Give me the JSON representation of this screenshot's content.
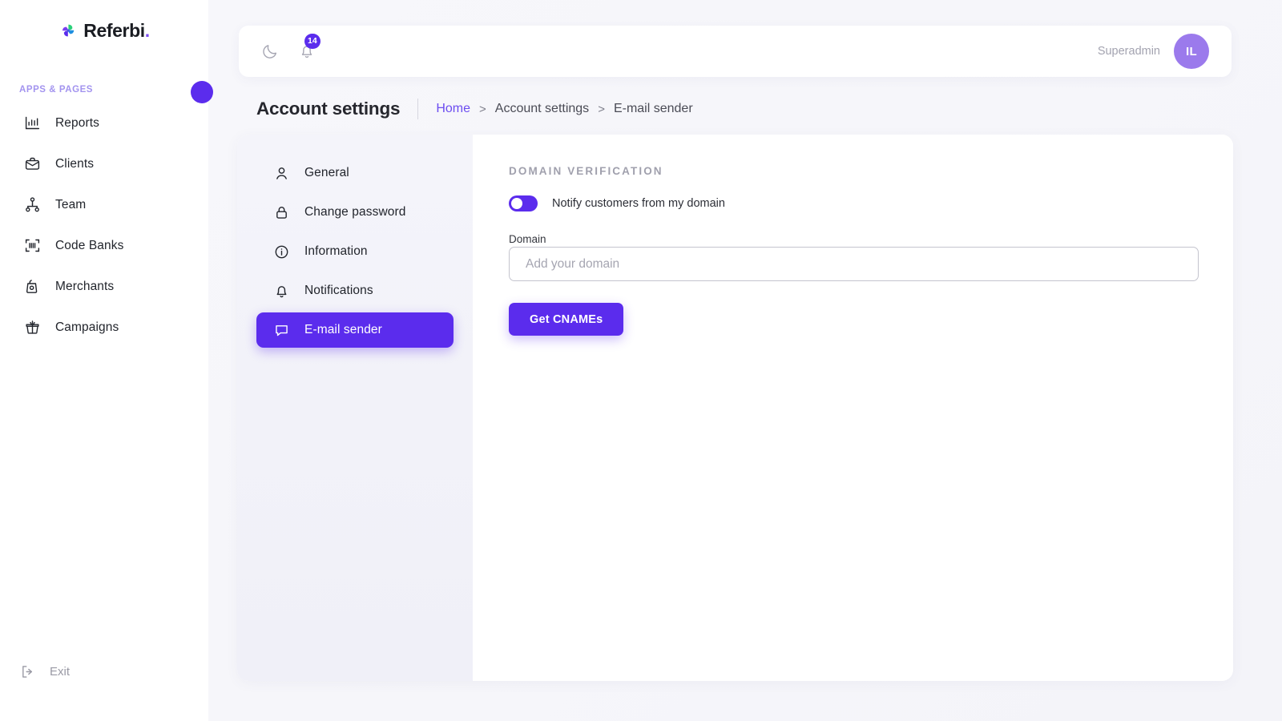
{
  "brand": {
    "name": "Referbi",
    "dot": ".",
    "accent": "#5b2ced",
    "logo_icon": "pinwheel-icon"
  },
  "sidebar": {
    "section_label": "APPS & PAGES",
    "items": [
      {
        "label": "Reports",
        "icon": "bar-chart-icon"
      },
      {
        "label": "Clients",
        "icon": "briefcase-icon"
      },
      {
        "label": "Team",
        "icon": "org-chart-icon"
      },
      {
        "label": "Code Banks",
        "icon": "barcode-scan-icon"
      },
      {
        "label": "Merchants",
        "icon": "shopping-bag-icon"
      },
      {
        "label": "Campaigns",
        "icon": "gift-box-icon"
      }
    ],
    "exit": {
      "label": "Exit",
      "icon": "logout-icon"
    }
  },
  "topbar": {
    "theme_toggle_icon": "moon-icon",
    "notifications_icon": "bell-icon",
    "notifications_count": "14",
    "user_name": "Superadmin",
    "avatar_initials": "IL"
  },
  "page": {
    "title": "Account settings",
    "breadcrumb": [
      {
        "label": "Home",
        "link": true
      },
      {
        "label": "Account settings",
        "link": false
      },
      {
        "label": "E-mail sender",
        "link": false
      }
    ],
    "breadcrumb_separator": ">"
  },
  "settings_nav": {
    "items": [
      {
        "label": "General",
        "icon": "user-icon",
        "active": false
      },
      {
        "label": "Change password",
        "icon": "lock-icon",
        "active": false
      },
      {
        "label": "Information",
        "icon": "info-icon",
        "active": false
      },
      {
        "label": "Notifications",
        "icon": "bell-icon",
        "active": false
      },
      {
        "label": "E-mail sender",
        "icon": "message-icon",
        "active": true
      }
    ]
  },
  "domain_verification": {
    "section_title": "DOMAIN VERIFICATION",
    "toggle_label": "Notify customers from my domain",
    "toggle_on": true,
    "field_label": "Domain",
    "field_value": "",
    "field_placeholder": "Add your domain",
    "submit_label": "Get CNAMEs"
  }
}
